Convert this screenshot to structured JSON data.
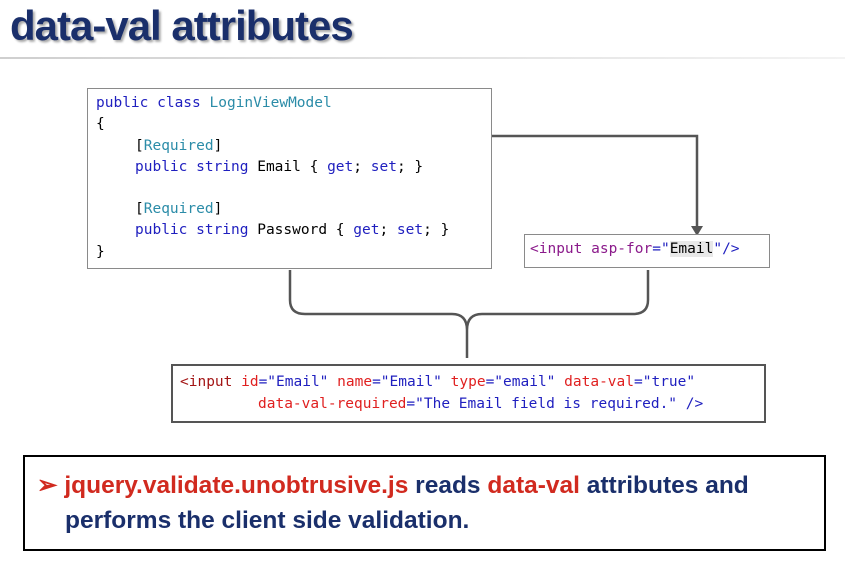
{
  "slide": {
    "title": "data-val attributes"
  },
  "model_code": {
    "line1_kw": "public class ",
    "line1_type": "LoginViewModel",
    "line2": "{",
    "line3_open": "[",
    "line3_attr": "Required",
    "line3_close": "]",
    "line4_kw": "public string ",
    "line4_name": "Email { ",
    "line4_get": "get",
    "line4_semi1": "; ",
    "line4_set": "set",
    "line4_end": "; }",
    "line5_open": "[",
    "line5_attr": "Required",
    "line5_close": "]",
    "line6_kw": "public string ",
    "line6_name": "Password { ",
    "line6_get": "get",
    "line6_semi1": "; ",
    "line6_set": "set",
    "line6_end": "; }",
    "line7": "}"
  },
  "tag_helper": {
    "open": "<input ",
    "attr": "asp-for",
    "eq": "=\"",
    "value": "Email",
    "close": "\"/>"
  },
  "rendered_html": {
    "l1_tag": "<input ",
    "l1_id_attr": "id",
    "l1_id_val": "=\"Email\" ",
    "l1_name_attr": "name",
    "l1_name_val": "=\"Email\" ",
    "l1_type_attr": "type",
    "l1_type_val": "=\"email\" ",
    "l1_dv_attr": "data-val",
    "l1_dv_val": "=\"true\"",
    "l2_attr": "data-val-required",
    "l2_val": "=\"The Email field is required.\" ",
    "l2_close": "/>"
  },
  "note": {
    "bullet": "➢",
    "part1": "jquery.validate.unobtrusive.js",
    "part2": " reads ",
    "part3": "data-val",
    "part4": " attributes and",
    "line2": "performs the client side validation."
  },
  "colors": {
    "title": "#1a2f6b",
    "keyword": "#1f1fbf",
    "type": "#2b8ca8",
    "html_attr": "#e02020",
    "note_highlight": "#d12a1f"
  }
}
